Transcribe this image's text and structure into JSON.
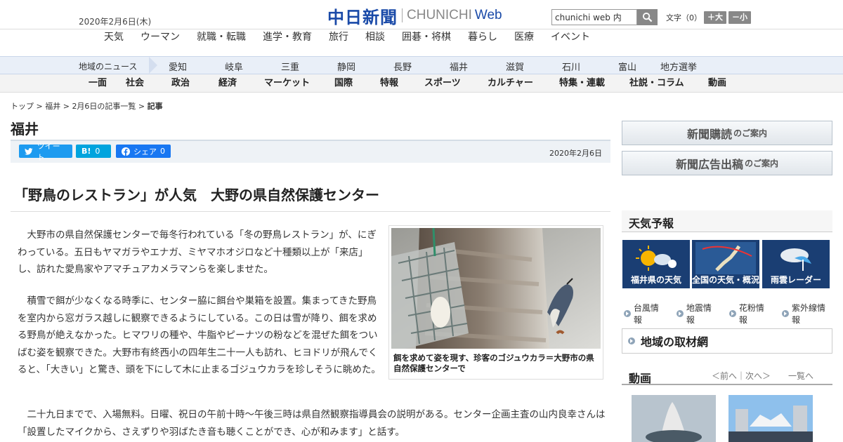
{
  "header": {
    "date": "2020年2月6日(木)",
    "logo_ja": "中日新聞",
    "logo_en": "CHUNICHI",
    "logo_web": "Web",
    "search_value": "chunichi web 内",
    "fontsize_label": "文字（0）",
    "fontsize_up": "＋大",
    "fontsize_down": "－小"
  },
  "nav1": [
    "天気",
    "ウーマン",
    "就職・転職",
    "進学・教育",
    "旅行",
    "相談",
    "囲碁・将棋",
    "暮らし",
    "医療",
    "イベント"
  ],
  "nav2": {
    "label": "地域のニュース",
    "items": [
      "愛知",
      "岐阜",
      "三重",
      "静岡",
      "長野",
      "福井",
      "滋賀",
      "石川",
      "富山",
      "地方選挙"
    ]
  },
  "nav3": [
    "一面",
    "社会",
    "政治",
    "経済",
    "マーケット",
    "国際",
    "特報",
    "スポーツ",
    "カルチャー",
    "特集・連載",
    "社説・コラム",
    "動画"
  ],
  "breadcrumb": [
    "トップ",
    "福井",
    "2月6日の記事一覧",
    "記事"
  ],
  "page_title": "福井",
  "share": {
    "tweet": "ツイート",
    "hatena": "B!",
    "hatena_count": "0",
    "facebook": "シェア",
    "facebook_count": "0",
    "date": "2020年2月6日"
  },
  "article": {
    "headline": "「野鳥のレストラン」が人気　大野の県自然保護センター",
    "paragraphs": [
      "　大野市の県自然保護センターで毎冬行われている「冬の野鳥レストラン」が、にぎわっている。五日もヤマガラやエナガ、ミヤマホオジロなど十種類以上が「来店」し、訪れた愛鳥家やアマチュアカメラマンらを楽しませた。",
      "　積雪で餌が少なくなる時季に、センター脇に餌台や巣箱を設置。集まってきた野鳥を室内から窓ガラス越しに観察できるようにしている。この日は雪が降り、餌を求める野鳥が絶えなかった。ヒマワリの種や、牛脂やピーナツの粉などを混ぜた餌をついばむ姿を観察できた。大野市有終西小の四年生二十一人も訪れ、ヒヨドリが飛んでくると、「大きい」と驚き、頭を下にして木に止まるゴジュウカラを珍しそうに眺めた。",
      "　二十九日までで、入場無料。日曜、祝日の午前十時～午後三時は県自然観察指導員会の説明がある。センター企画主査の山内良幸さんは「設置したマイクから、さえずりや羽ばたき音も聴くことができ、心が和みます」と話す。"
    ],
    "photo_caption": "餌を求めて姿を現す、珍客のゴジュウカラ＝大野市の県自然保護センターで"
  },
  "sidebar": {
    "subscribe": "新聞購読",
    "subscribe_sub": "のご案内",
    "advertise": "新聞広告出稿",
    "advertise_sub": "のご案内",
    "weather_title": "天気予報",
    "weather_boxes": [
      "福井県の天気",
      "全国の天気・概況",
      "雨雲レーダー"
    ],
    "weather_links": [
      "台風情報",
      "地震情報",
      "花粉情報",
      "紫外線情報"
    ],
    "region_title": "地域の取材網",
    "video_title": "動画",
    "video_nav": "＜前へ｜次へ＞",
    "video_list": "一覧へ"
  },
  "colors": {
    "brand_blue": "#1a4aa8",
    "nav_bg": "#e9eff8",
    "twitter": "#1d9bf0",
    "hatena": "#00a4de",
    "facebook": "#1877f2",
    "weather_box": "#1a3e73"
  }
}
